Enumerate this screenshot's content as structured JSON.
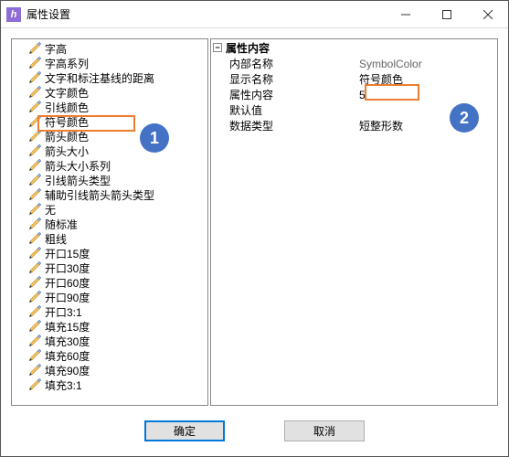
{
  "window": {
    "title": "属性设置"
  },
  "tree": {
    "items": [
      "字高",
      "字高系列",
      "文字和标注基线的距离",
      "文字颜色",
      "引线颜色",
      "符号颜色",
      "箭头颜色",
      "箭头大小",
      "箭头大小系列",
      "引线箭头类型",
      "辅助引线箭头箭头类型",
      "无",
      "随标准",
      "粗线",
      "开口15度",
      "开口30度",
      "开口60度",
      "开口90度",
      "开口3:1",
      "填充15度",
      "填充30度",
      "填充60度",
      "填充90度",
      "填充3:1"
    ]
  },
  "properties": {
    "section_title": "属性内容",
    "rows": [
      {
        "label": "内部名称",
        "value": "SymbolColor",
        "gray": true
      },
      {
        "label": "显示名称",
        "value": "符号颜色",
        "gray": false
      },
      {
        "label": "属性内容",
        "value": "5",
        "gray": false
      },
      {
        "label": "默认值",
        "value": "",
        "gray": false
      },
      {
        "label": "数据类型",
        "value": "短整形数",
        "gray": false
      }
    ]
  },
  "buttons": {
    "ok": "确定",
    "cancel": "取消"
  },
  "annotations": {
    "one": "1",
    "two": "2"
  }
}
